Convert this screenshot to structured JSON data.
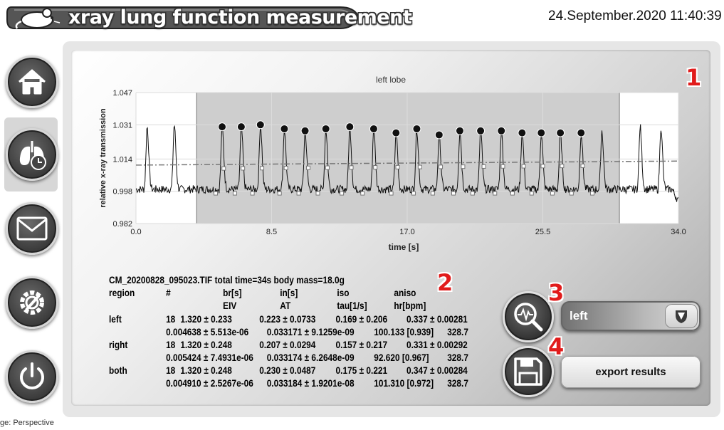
{
  "app": {
    "title": "xray lung function measurement",
    "datetime": "24.September.2020 11:40:39"
  },
  "sidebar": {
    "items": [
      {
        "icon": "home-icon"
      },
      {
        "icon": "lungs-clock-icon",
        "active": true
      },
      {
        "icon": "mail-icon"
      },
      {
        "icon": "settings-wrench-icon"
      },
      {
        "icon": "power-icon"
      }
    ]
  },
  "badges": {
    "one": "1",
    "two": "2",
    "three": "3",
    "four": "4"
  },
  "chart_data": {
    "type": "line",
    "title": "left lobe",
    "xlabel": "time [s]",
    "ylabel": "relative x-ray transmission",
    "xlim": [
      0.0,
      34.0
    ],
    "ylim": [
      0.982,
      1.047
    ],
    "x_ticks": [
      "0.0",
      "8.5",
      "17.0",
      "25.5",
      "34.0"
    ],
    "y_ticks": [
      "0.982",
      "0.998",
      "1.014",
      "1.031",
      "1.047"
    ],
    "grid": true,
    "selection_range": [
      3.8,
      30.3
    ],
    "peaks": [
      {
        "t": 0.7,
        "v": 1.03
      },
      {
        "t": 2.4,
        "v": 1.031
      },
      {
        "t": 5.4,
        "v": 1.03
      },
      {
        "t": 6.6,
        "v": 1.03
      },
      {
        "t": 7.8,
        "v": 1.031
      },
      {
        "t": 9.3,
        "v": 1.029
      },
      {
        "t": 10.6,
        "v": 1.028
      },
      {
        "t": 11.9,
        "v": 1.029
      },
      {
        "t": 13.4,
        "v": 1.03
      },
      {
        "t": 14.9,
        "v": 1.029
      },
      {
        "t": 16.3,
        "v": 1.027
      },
      {
        "t": 17.6,
        "v": 1.029
      },
      {
        "t": 19.0,
        "v": 1.026
      },
      {
        "t": 20.3,
        "v": 1.028
      },
      {
        "t": 21.6,
        "v": 1.028
      },
      {
        "t": 22.9,
        "v": 1.028
      },
      {
        "t": 24.2,
        "v": 1.027
      },
      {
        "t": 25.4,
        "v": 1.027
      },
      {
        "t": 26.6,
        "v": 1.027
      },
      {
        "t": 27.9,
        "v": 1.027
      },
      {
        "t": 29.2,
        "v": 1.028
      },
      {
        "t": 31.6,
        "v": 1.03
      },
      {
        "t": 32.9,
        "v": 1.03
      }
    ],
    "baseline": 0.999,
    "trend_line": {
      "start": 1.011,
      "end": 1.013
    },
    "markers_peak": [
      5.4,
      6.6,
      7.8,
      9.3,
      10.6,
      11.9,
      13.4,
      14.9,
      16.3,
      17.6,
      19.0,
      20.3,
      21.6,
      22.9,
      24.2,
      25.4,
      26.6,
      27.9
    ],
    "markers_mid": [
      5.5,
      6.7,
      7.9,
      9.4,
      10.8,
      12.0,
      13.5,
      15.0,
      16.4,
      17.8,
      19.1,
      20.5,
      21.8,
      23.0,
      24.3,
      25.5,
      26.7,
      28.0
    ],
    "markers_low": [
      5.0,
      6.2,
      7.3,
      9.0,
      10.2,
      11.4,
      12.9,
      14.2,
      16.0,
      17.4,
      18.6,
      19.9,
      21.1,
      22.5,
      23.6,
      24.8,
      26.1,
      27.3,
      28.6
    ]
  },
  "results": {
    "header": "CM_20200828_095023.TIF total time=34s   body mass=18.0g",
    "columns1": [
      "region",
      "#",
      "br[s]",
      "in[s]",
      "iso",
      "aniso"
    ],
    "columns2": [
      "EIV",
      "AT",
      "tau[1/s]",
      "hr[bpm]"
    ],
    "rows": [
      {
        "region": "left",
        "line1": [
          "18",
          "1.320 ± 0.233",
          "0.223 ± 0.0733",
          "0.169 ± 0.206",
          "0.337 ± 0.00281"
        ],
        "line2": [
          "0.004638 ± 5.513e-06",
          "0.033171 ± 9.1259e-09",
          "100.133 [0.939]",
          "328.7"
        ]
      },
      {
        "region": "right",
        "line1": [
          "18",
          "1.320 ± 0.248",
          "0.207 ± 0.0294",
          "0.157 ± 0.217",
          "0.331 ± 0.00292"
        ],
        "line2": [
          "0.005424 ± 7.4931e-06",
          "0.033174 ± 6.2648e-09",
          "92.620 [0.967]",
          "328.7"
        ]
      },
      {
        "region": "both",
        "line1": [
          "18",
          "1.320 ± 0.248",
          "0.230 ± 0.0487",
          "0.175 ± 0.221",
          "0.347 ± 0.00284"
        ],
        "line2": [
          "0.004910 ± 2.5267e-06",
          "0.033184 ± 1.9201e-08",
          "101.310 [0.972]",
          "328.7"
        ]
      }
    ]
  },
  "controls": {
    "analyze_icon": "magnifier-pulse-icon",
    "save_icon": "floppy-disk-icon",
    "lobe_select": {
      "value": "left"
    },
    "export_label": "export results"
  },
  "footer_fragment": "ge: Perspective"
}
